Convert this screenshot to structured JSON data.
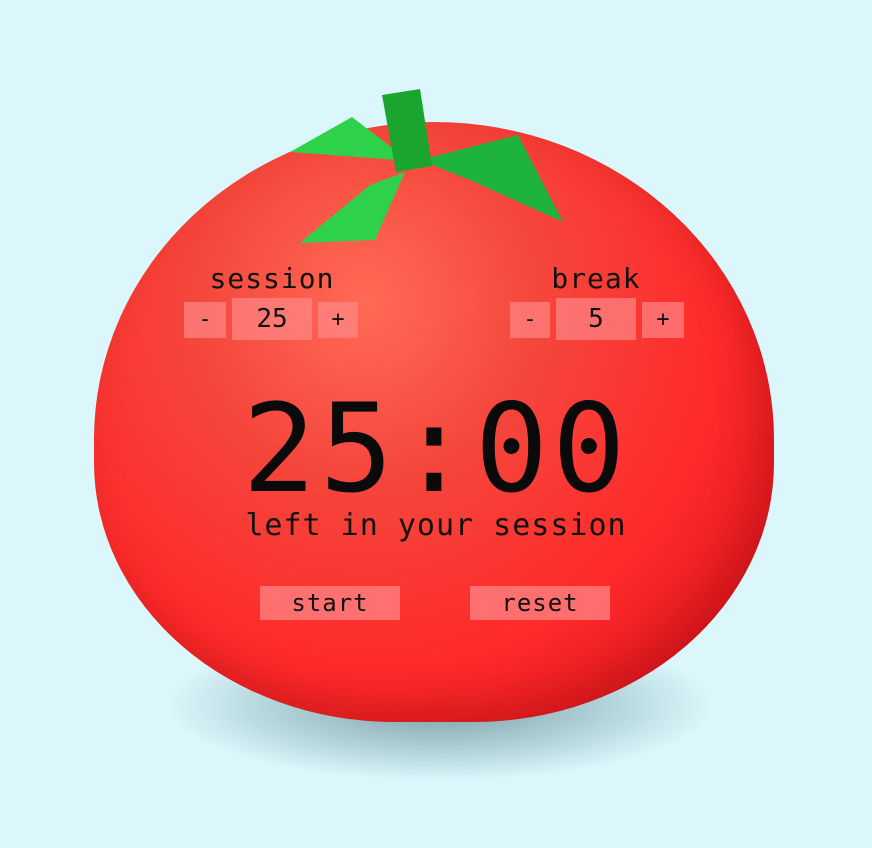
{
  "session": {
    "label": "session",
    "decrement": "-",
    "value": "25",
    "increment": "+"
  },
  "break": {
    "label": "break",
    "decrement": "-",
    "value": "5",
    "increment": "+"
  },
  "timer": {
    "display": "25:00",
    "status": "left in your session"
  },
  "controls": {
    "start_label": "start",
    "reset_label": "reset"
  },
  "colors": {
    "background": "#dcf7fc",
    "tomato": "#ff2a2a",
    "leaf_light": "#2ecc40",
    "leaf_dark": "#1aaa2e",
    "button": "#ff8c8c"
  }
}
